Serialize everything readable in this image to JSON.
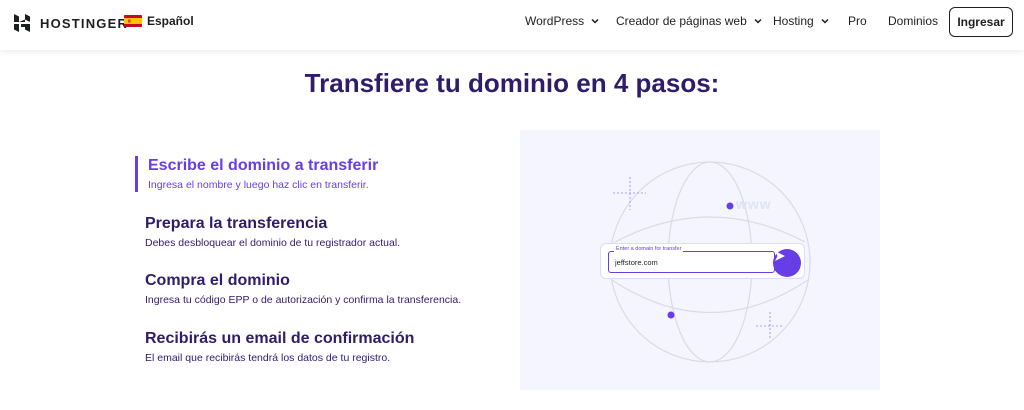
{
  "brand": {
    "name": "HOSTINGER"
  },
  "language": {
    "label": "Español",
    "flag_icon": "spain-flag-icon"
  },
  "nav": {
    "items": [
      {
        "label": "WordPress",
        "has_dropdown": true
      },
      {
        "label": "Creador de páginas web",
        "has_dropdown": true
      },
      {
        "label": "Hosting",
        "has_dropdown": true
      },
      {
        "label": "Pro",
        "has_dropdown": false
      },
      {
        "label": "Dominios",
        "has_dropdown": false
      }
    ],
    "login_label": "Ingresar"
  },
  "page": {
    "title": "Transfiere tu dominio en 4 pasos:"
  },
  "steps": [
    {
      "title": "Escribe el dominio a transferir",
      "desc": "Ingresa el nombre y luego haz clic en transferir.",
      "active": true
    },
    {
      "title": "Prepara la transferencia",
      "desc": "Debes desbloquear el dominio de tu registrador actual.",
      "active": false
    },
    {
      "title": "Compra el dominio",
      "desc": "Ingresa tu código EPP o de autorización y confirma la transferencia.",
      "active": false
    },
    {
      "title": "Recibirás un email de confirmación",
      "desc": "El email que recibirás tendrá los datos de tu registro.",
      "active": false
    }
  ],
  "illustration": {
    "input_label": "Enter a domain for transfer",
    "input_value": "jeffstore.com",
    "www_text": "www"
  },
  "colors": {
    "accent": "#673de6",
    "text_dark": "#2f1c6a",
    "illustration_bg": "#f4f5ff"
  }
}
